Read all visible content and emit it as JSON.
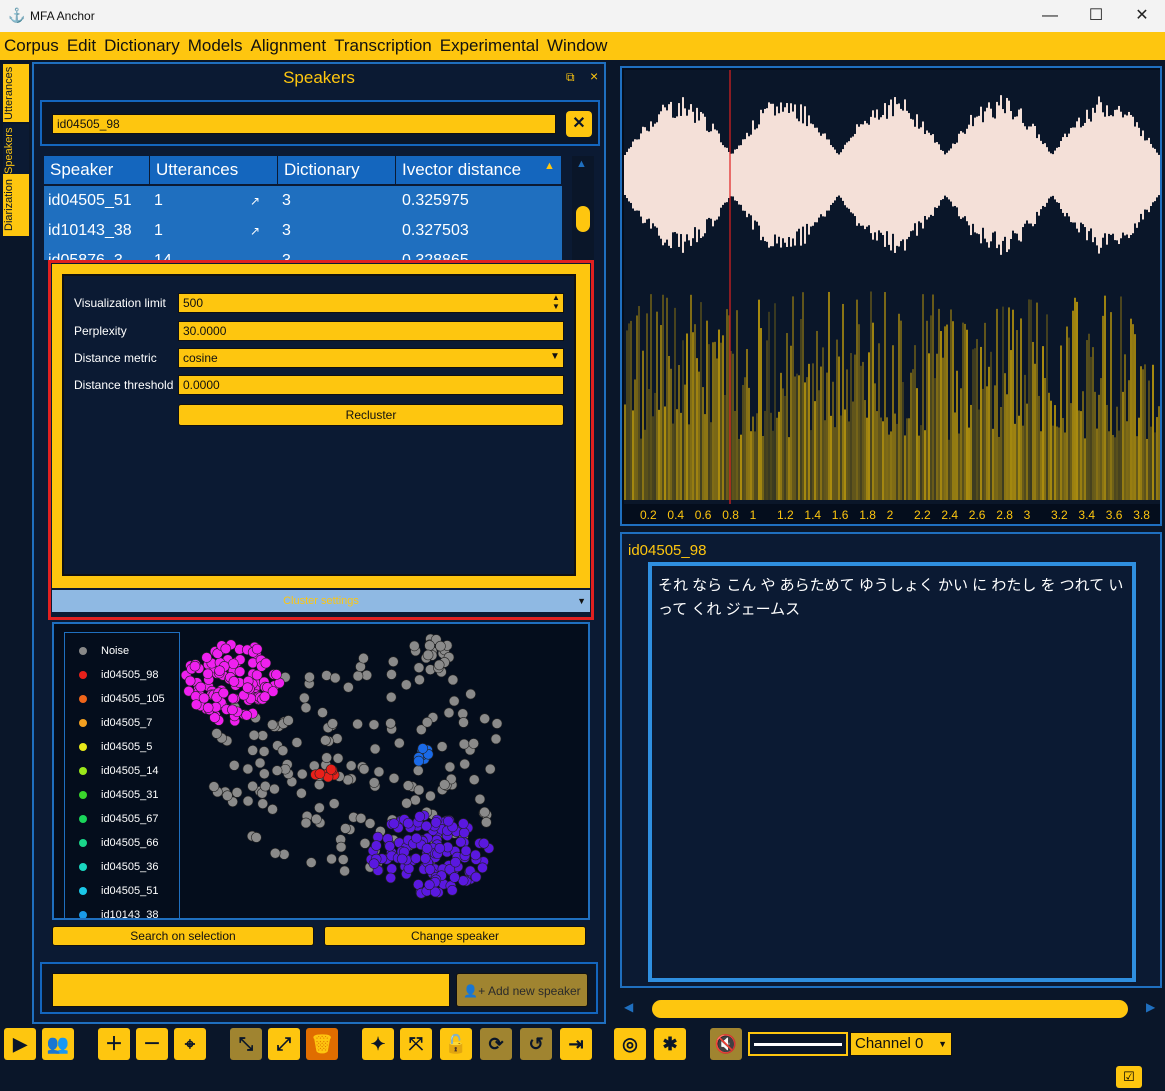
{
  "window": {
    "title": "MFA Anchor",
    "minimize": "—",
    "maximize": "☐",
    "close": "✕"
  },
  "menu": [
    "Corpus",
    "Edit",
    "Dictionary",
    "Models",
    "Alignment",
    "Transcription",
    "Experimental",
    "Window"
  ],
  "side_tabs": [
    "Utterances",
    "Speakers",
    "Diarization"
  ],
  "speakers_panel": {
    "title": "Speakers",
    "search_value": "id04505_98",
    "columns": [
      "Speaker",
      "Utterances",
      "Dictionary",
      "Ivector distance"
    ],
    "rows": [
      {
        "speaker": "id04505_51",
        "utterances": "1",
        "dictionary": "3",
        "distance": "0.325975"
      },
      {
        "speaker": "id10143_38",
        "utterances": "1",
        "dictionary": "3",
        "distance": "0.327503"
      },
      {
        "speaker": "id05876_3",
        "utterances": "14",
        "dictionary": "3",
        "distance": "0.328865"
      }
    ],
    "cluster": {
      "visualization_limit_label": "Visualization limit",
      "visualization_limit": "500",
      "perplexity_label": "Perplexity",
      "perplexity": "30.0000",
      "distance_metric_label": "Distance metric",
      "distance_metric": "cosine",
      "distance_threshold_label": "Distance threshold",
      "distance_threshold": "0.0000",
      "recluster": "Recluster",
      "section_label": "Cluster settings"
    },
    "legend": [
      {
        "label": "Noise",
        "color": "#888888"
      },
      {
        "label": "id04505_98",
        "color": "#e8201a"
      },
      {
        "label": "id04505_105",
        "color": "#f0651a"
      },
      {
        "label": "id04505_7",
        "color": "#f4a020"
      },
      {
        "label": "id04505_5",
        "color": "#e8e81a"
      },
      {
        "label": "id04505_14",
        "color": "#9be81a"
      },
      {
        "label": "id04505_31",
        "color": "#3ad62c"
      },
      {
        "label": "id04505_67",
        "color": "#1ad65a"
      },
      {
        "label": "id04505_66",
        "color": "#1ad68a"
      },
      {
        "label": "id04505_36",
        "color": "#1ad6c0"
      },
      {
        "label": "id04505_51",
        "color": "#1ac8e8"
      },
      {
        "label": "id10143_38",
        "color": "#1a9ae8"
      }
    ],
    "search_on_selection": "Search on selection",
    "change_speaker": "Change speaker",
    "new_speaker_value": "",
    "add_new_speaker": "Add new speaker"
  },
  "waveform": {
    "ticks": [
      "0.2",
      "0.4",
      "0.6",
      "0.8",
      "1",
      "1.2",
      "1.4",
      "1.6",
      "1.8",
      "2",
      "2.2",
      "2.4",
      "2.6",
      "2.8",
      "3",
      "3.2",
      "3.4",
      "3.6",
      "3.8"
    ]
  },
  "utterance": {
    "speaker": "id04505_98",
    "text": "それ なら こん や あらためて ゆうしょく かい に わたし を つれて いって くれ ジェームス"
  },
  "toolbar": {
    "channel": "Channel 0"
  },
  "colors": {
    "accent": "#fec60f",
    "panel": "#0b1a33",
    "selected_row": "#1f6fbf"
  }
}
